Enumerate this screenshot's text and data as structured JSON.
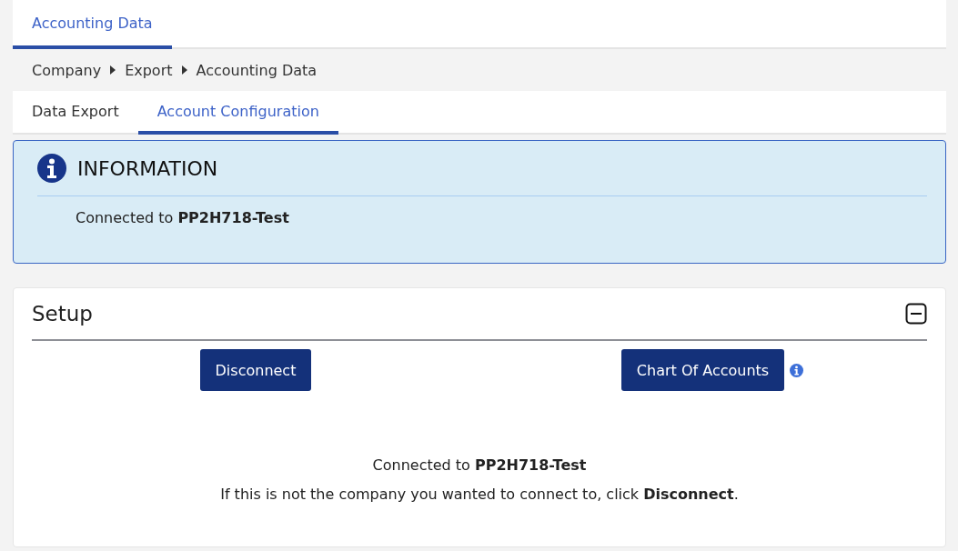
{
  "top_tabs": [
    {
      "label": "Accounting Data",
      "selected": true
    }
  ],
  "breadcrumb": [
    "Company",
    "Export",
    "Accounting Data"
  ],
  "tabs": [
    {
      "label": "Data Export",
      "selected": false
    },
    {
      "label": "Account Configuration",
      "selected": true
    }
  ],
  "info_box": {
    "title": "INFORMATION",
    "message": "Connected to **PP2H718-Test**"
  },
  "setup": {
    "title": "Setup",
    "expanded": true,
    "buttons": [
      {
        "label": "Disconnect",
        "has_info": false
      },
      {
        "label": "Chart Of Accounts",
        "has_info": true
      }
    ],
    "messages": [
      "Connected to **PP2H718-Test**",
      "If this is not the company you wanted to connect to, click **Disconnect**."
    ]
  }
}
